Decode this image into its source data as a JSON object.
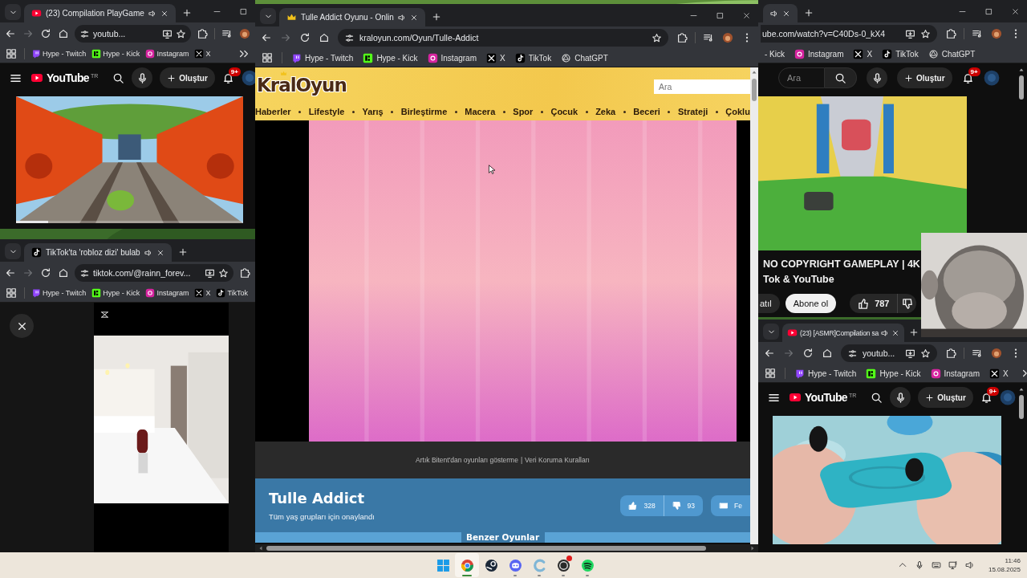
{
  "desktop": {
    "wallpaper": {
      "kind": "picture"
    }
  },
  "windows": [
    {
      "left_edge_hidden": false,
      "tabs": [
        {
          "title": "(23) Compilation PlayGame",
          "kind": "youtube",
          "audio": true,
          "selected": true
        }
      ],
      "window_controls": [
        {
          "kind": "minimize"
        },
        {
          "kind": "maximize"
        }
      ],
      "forward_disabled": true,
      "address": "youtub...",
      "install_button": true,
      "profile_visible": true,
      "menu_button": false,
      "bookmarks": [
        {
          "label": "Hype - Twitch",
          "kind": "twitch"
        },
        {
          "label": "Hype - Kick",
          "kind": "kick"
        },
        {
          "label": "Instagram",
          "kind": "instagram"
        },
        {
          "label": "X",
          "kind": "x"
        }
      ],
      "bookmarks_overflow": true,
      "content": {
        "kind": "youtube",
        "header": {
          "logo": "YouTube",
          "region": "TR",
          "create": "Oluştur",
          "notifications": "9+"
        },
        "video": {
          "kind": "picture"
        },
        "progress": {
          "level": 0.14
        }
      }
    },
    {
      "left_edge_hidden": false,
      "tabs": [
        {
          "title": "TikTok'ta 'robloz dizi' bulab",
          "kind": "tiktok",
          "audio": true,
          "selected": true
        }
      ],
      "forward_disabled": true,
      "address": "tiktok.com/@rainn_forev...",
      "install_button": true,
      "profile_visible": false,
      "menu_button": false,
      "bookmarks": [
        {
          "label": "Hype - Twitch",
          "kind": "twitch"
        },
        {
          "label": "Hype - Kick",
          "kind": "kick"
        },
        {
          "label": "Instagram",
          "kind": "instagram"
        },
        {
          "label": "X",
          "kind": "x"
        },
        {
          "label": "TikTok",
          "kind": "tiktok"
        }
      ],
      "bookmarks_overflow": false,
      "content": {
        "kind": "tiktok",
        "close_button": true,
        "video": {
          "kind": "picture"
        }
      }
    },
    {
      "left_edge_hidden": false,
      "tabs": [
        {
          "title": "Tulle Addict Oyunu - Onlin",
          "kind": "crown",
          "audio": true,
          "selected": true
        }
      ],
      "window_controls": [
        {
          "kind": "minimize"
        },
        {
          "kind": "maximize"
        },
        {
          "kind": "close"
        }
      ],
      "forward_disabled": true,
      "address": "kraloyun.com/Oyun/Tulle-Addict",
      "install_button": false,
      "profile_visible": true,
      "menu_button": true,
      "bookmarks": [
        {
          "label": "Hype - Twitch",
          "kind": "twitch"
        },
        {
          "label": "Hype - Kick",
          "kind": "kick"
        },
        {
          "label": "Instagram",
          "kind": "instagram"
        },
        {
          "label": "X",
          "kind": "x"
        },
        {
          "label": "TikTok",
          "kind": "tiktok"
        },
        {
          "label": "ChatGPT",
          "kind": "chatgpt"
        }
      ],
      "bookmarks_overflow": false,
      "content": {
        "kind": "game_site",
        "logo": "KralOyun",
        "search_placeholder": "Ara",
        "categories": [
          "Haberler",
          "Lifestyle",
          "Yarış",
          "Birleştirme",
          "Macera",
          "Spor",
          "Çocuk",
          "Zeka",
          "Beceri",
          "Strateji",
          "Çoklu"
        ],
        "game": {
          "kind": "picture"
        },
        "cursor": true,
        "footer": {
          "links": [
            "Artık Bitent'dan oyunları gösterme",
            "Veri Koruma Kuralları"
          ],
          "separator": "|"
        },
        "title": "Tulle Addict",
        "subtitle": "Tüm yaş grupları için onaylandı",
        "likes": "328",
        "dislikes": "93",
        "share": "Fe",
        "section_heading": "Benzer Oyunlar"
      }
    },
    {
      "left_edge_hidden": true,
      "tabs": [
        {
          "audio": true,
          "selected": true
        }
      ],
      "window_controls": [
        {
          "kind": "minimize"
        },
        {
          "kind": "maximize"
        },
        {
          "kind": "close"
        }
      ],
      "address": "ube.com/watch?v=C40Ds-0_kX4",
      "install_button": true,
      "profile_visible": true,
      "menu_button": true,
      "bookmarks": [
        {
          "label": "- Kick",
          "kind": "none"
        },
        {
          "label": "Instagram",
          "kind": "instagram"
        },
        {
          "label": "X",
          "kind": "x"
        },
        {
          "label": "TikTok",
          "kind": "tiktok"
        },
        {
          "label": "ChatGPT",
          "kind": "chatgpt"
        }
      ],
      "bookmarks_overflow": false,
      "content": {
        "kind": "youtube",
        "header": {
          "search_placeholder": "Ara",
          "create": "Oluştur",
          "notifications": "9+"
        },
        "video": {
          "kind": "picture"
        },
        "title_lines": [
          "NO COPYRIGHT GAMEPLAY | 4K",
          "Tok & YouTube"
        ],
        "actions": {
          "join": "atıl",
          "subscribe": "Abone ol",
          "likes": "787"
        },
        "scrollbar": true
      }
    },
    {
      "left_edge_hidden": false,
      "tabs": [
        {
          "title": "(23) [ASMR]Compilation sa",
          "kind": "youtube",
          "audio": true,
          "selected": true
        }
      ],
      "forward_disabled": true,
      "address": "youtub...",
      "install_button": true,
      "profile_visible": true,
      "menu_button": true,
      "bookmarks": [
        {
          "label": "Hype - Twitch",
          "kind": "twitch"
        },
        {
          "label": "Hype - Kick",
          "kind": "kick"
        },
        {
          "label": "Instagram",
          "kind": "instagram"
        },
        {
          "label": "X",
          "kind": "x"
        }
      ],
      "bookmarks_overflow": true,
      "content": {
        "kind": "youtube",
        "header": {
          "logo": "YouTube",
          "region": "TR",
          "create": "Oluştur",
          "notifications": "9+"
        },
        "video": {
          "kind": "picture"
        },
        "scrollbar": true
      }
    }
  ],
  "webcam_overlay": {
    "kind": "picture"
  },
  "taskbar": {
    "apps": [
      {
        "kind": "start",
        "running": false,
        "selected": false,
        "notification": false
      },
      {
        "kind": "browser",
        "running": true,
        "selected": true,
        "notification": false
      },
      {
        "kind": "steam",
        "running": false,
        "selected": false,
        "notification": false
      },
      {
        "kind": "discord",
        "running": true,
        "selected": false,
        "notification": false
      },
      {
        "kind": "cleaner",
        "running": true,
        "selected": false,
        "notification": false
      },
      {
        "kind": "recorder",
        "running": true,
        "selected": false,
        "notification": true
      },
      {
        "kind": "music",
        "running": true,
        "selected": false,
        "notification": false
      }
    ],
    "tray": {
      "time": "11:46",
      "date": "15.08.2025"
    }
  }
}
